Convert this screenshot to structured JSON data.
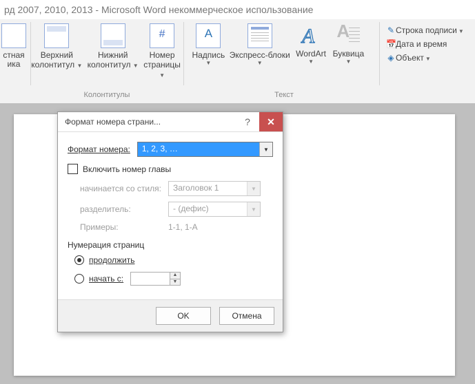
{
  "window_title": "рд 2007, 2010, 2013  -  Microsoft Word некоммерческое использование",
  "ribbon": {
    "partial": {
      "l1": "стная",
      "l2": "ика"
    },
    "header": {
      "l1": "Верхний",
      "l2": "колонтитул"
    },
    "footer": {
      "l1": "Нижний",
      "l2": "колонтитул"
    },
    "pagenum": {
      "l1": "Номер",
      "l2": "страницы"
    },
    "group_hf": "Колонтитулы",
    "textbox": "Надпись",
    "quick": "Экспресс-блоки",
    "wordart": "WordArt",
    "dropcap": "Буквица",
    "group_text": "Текст",
    "sig": "Строка подписи",
    "datetime": "Дата и время",
    "object": "Объект"
  },
  "dialog": {
    "title": "Формат номера страни...",
    "format_label": "Формат номера:",
    "format_value": "1, 2, 3, …",
    "include_chapter": "Включить номер главы",
    "starts_with_style": "начинается со стиля:",
    "style_value": "Заголовок 1",
    "separator_label": "разделитель:",
    "separator_value": "-    (дефис)",
    "examples_label": "Примеры:",
    "examples_value": "1-1, 1-A",
    "numbering_title": "Нумерация страниц",
    "continue": "продолжить",
    "start_at": "начать с:",
    "start_value": "",
    "ok": "OK",
    "cancel": "Отмена"
  }
}
